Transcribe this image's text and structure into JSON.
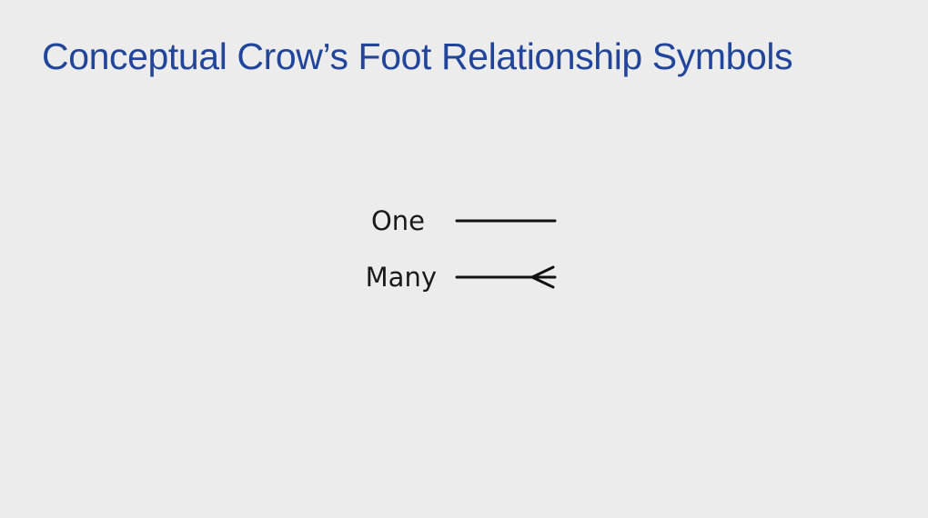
{
  "slide": {
    "title": "Conceptual Crow’s Foot Relationship Symbols",
    "title_color": "#21459a",
    "background": "#ececec"
  },
  "symbols": [
    {
      "label": "One",
      "notation": "single-line"
    },
    {
      "label": "Many",
      "notation": "crows-foot"
    }
  ]
}
